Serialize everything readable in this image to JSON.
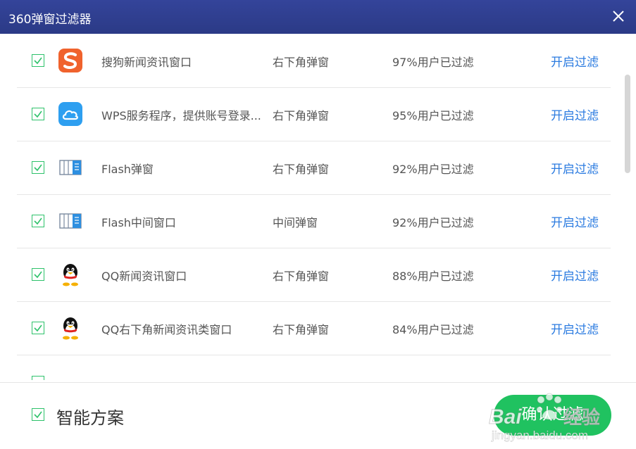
{
  "window": {
    "title": "360弹窗过滤器"
  },
  "rows": [
    {
      "name": "搜狗新闻资讯窗口",
      "type": "右下角弹窗",
      "rate": "97%用户已过滤",
      "action": "开启过滤",
      "icon": "sogou-icon"
    },
    {
      "name": "WPS服务程序，提供账号登录...",
      "type": "右下角弹窗",
      "rate": "95%用户已过滤",
      "action": "开启过滤",
      "icon": "cloud-icon"
    },
    {
      "name": "Flash弹窗",
      "type": "右下角弹窗",
      "rate": "92%用户已过滤",
      "action": "开启过滤",
      "icon": "flash-window-icon"
    },
    {
      "name": "Flash中间窗口",
      "type": "中间弹窗",
      "rate": "92%用户已过滤",
      "action": "开启过滤",
      "icon": "flash-window-icon"
    },
    {
      "name": "QQ新闻资讯窗口",
      "type": "右下角弹窗",
      "rate": "88%用户已过滤",
      "action": "开启过滤",
      "icon": "qq-penguin-icon"
    },
    {
      "name": "QQ右下角新闻资讯类窗口",
      "type": "右下角弹窗",
      "rate": "84%用户已过滤",
      "action": "开启过滤",
      "icon": "qq-penguin-icon"
    }
  ],
  "footer": {
    "smart_label": "智能方案",
    "confirm_label": "确认过滤"
  },
  "colors": {
    "titlebar": "#2f3e8f",
    "accent_green": "#20c260",
    "link_blue": "#2b7be0"
  }
}
